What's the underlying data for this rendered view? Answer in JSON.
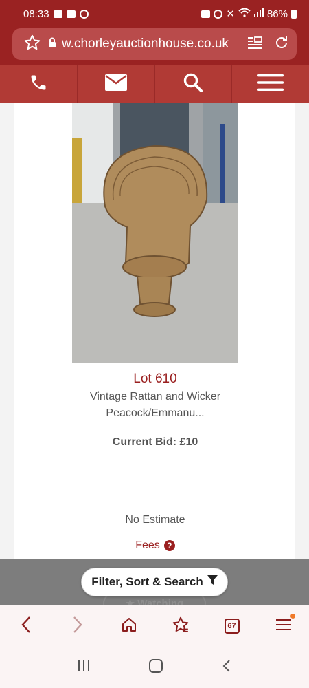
{
  "status": {
    "time": "08:33",
    "battery": "86%"
  },
  "browser": {
    "url": "w.chorleyauctionhouse.co.uk",
    "tab_count": "67"
  },
  "nav": {
    "icons": [
      "phone-icon",
      "mail-icon",
      "search-icon",
      "menu-icon"
    ]
  },
  "lot": {
    "title": "Lot 610",
    "description": "Vintage Rattan and Wicker Peacock/Emmanu...",
    "current_bid": "Current Bid: £10",
    "estimate": "No Estimate",
    "fees_label": "Fees"
  },
  "filter": {
    "button_label": "Filter, Sort & Search",
    "watching_label": "Watching"
  },
  "colors": {
    "brand": "#9a2222",
    "accent": "#9a1f1f"
  }
}
